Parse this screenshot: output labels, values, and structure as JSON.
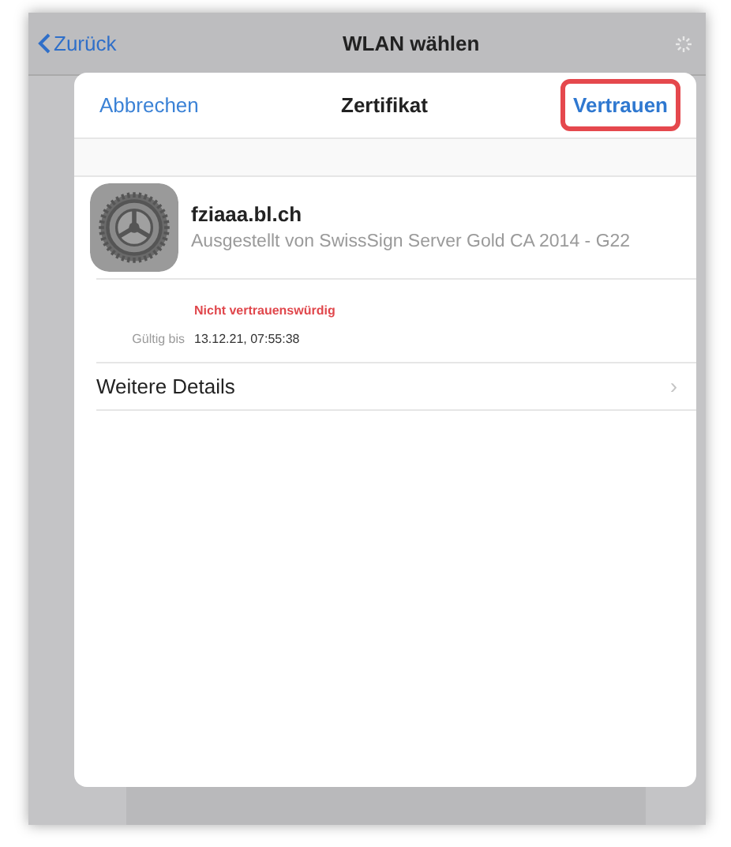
{
  "nav_bar": {
    "back": "Zurück",
    "title": "WLAN wählen"
  },
  "sheet": {
    "cancel": "Abbrechen",
    "title": "Zertifikat",
    "trust": "Vertrauen",
    "trust_highlighted": true
  },
  "certificate": {
    "name": "fziaaa.bl.ch",
    "issuer": "Ausgestellt von SwissSign Server Gold CA 2014 - G22",
    "status": "Nicht vertrauenswürdig",
    "valid_label": "Gültig bis",
    "valid_value": "13.12.21, 07:55:38"
  },
  "details_row": {
    "label": "Weitere Details",
    "chevron": "›"
  }
}
